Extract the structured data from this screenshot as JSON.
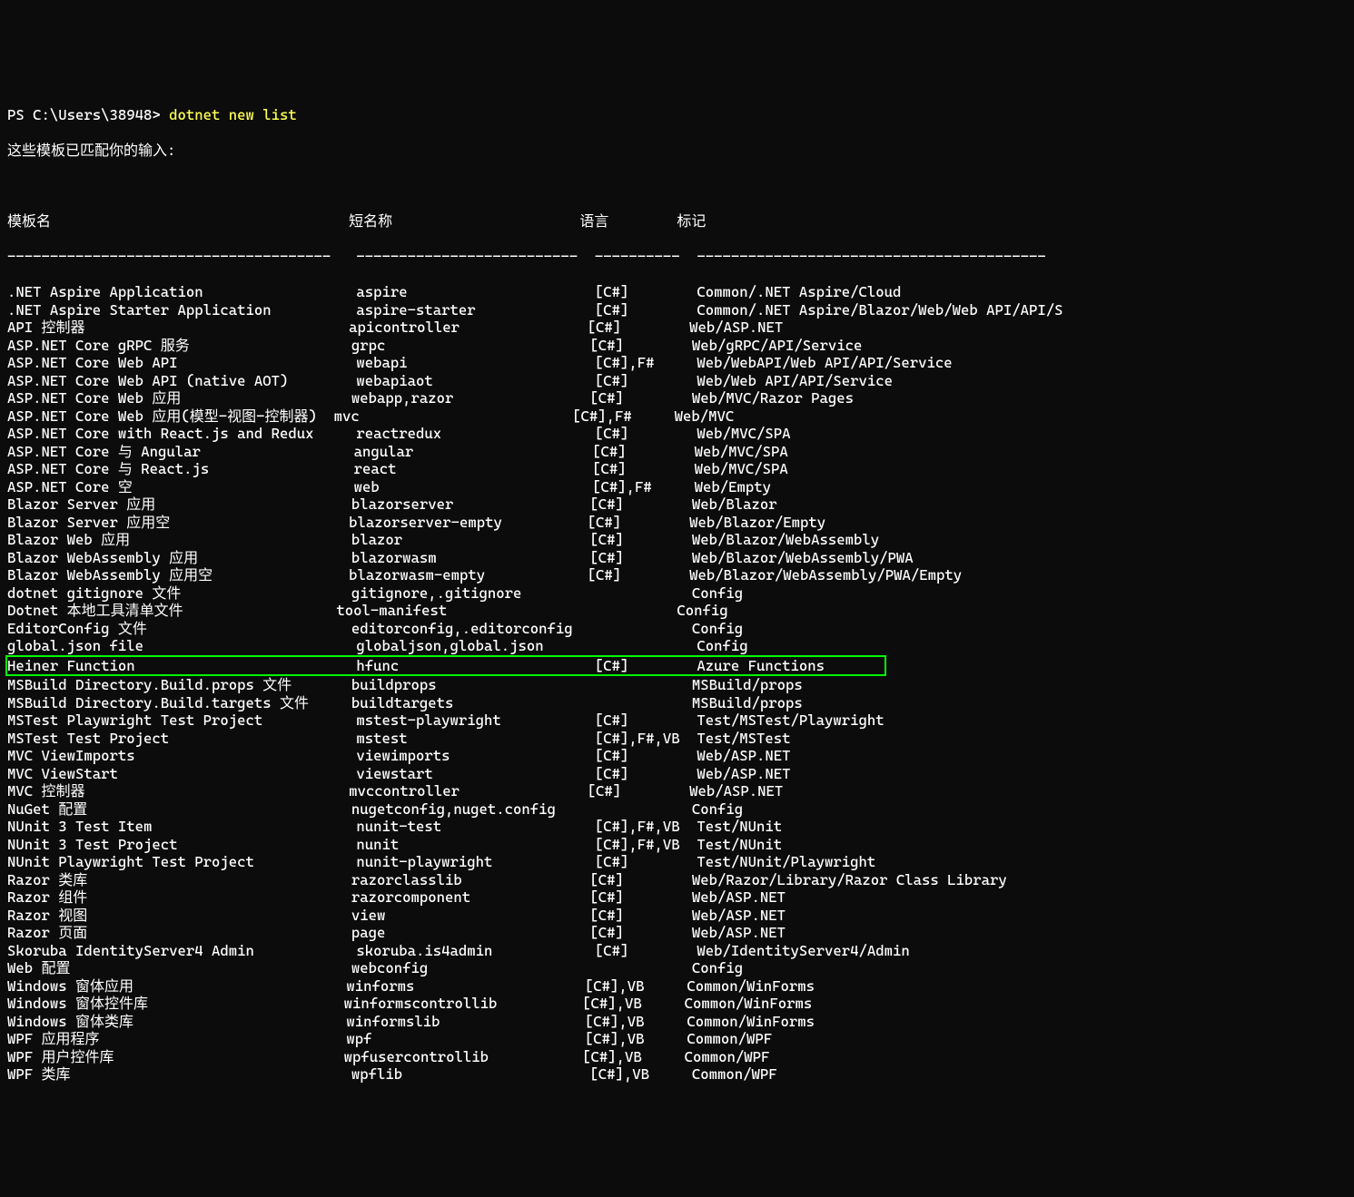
{
  "prompt_prefix": "PS C:\\Users\\38948> ",
  "command": "dotnet new list",
  "message": "这些模板已匹配你的输入:",
  "headers": {
    "name": "模板名",
    "short": "短名称",
    "lang": "语言",
    "tags": "标记"
  },
  "dashes": {
    "name": "--------------------------------------",
    "short": "--------------------------",
    "lang": "----------",
    "tags": "-----------------------------------------"
  },
  "rows": [
    {
      "name": ".NET Aspire Application",
      "short": "aspire",
      "lang": "[C#]",
      "tags": "Common/.NET Aspire/Cloud"
    },
    {
      "name": ".NET Aspire Starter Application",
      "short": "aspire-starter",
      "lang": "[C#]",
      "tags": "Common/.NET Aspire/Blazor/Web/Web API/API/S"
    },
    {
      "name": "API 控制器",
      "short": "apicontroller",
      "lang": "[C#]",
      "tags": "Web/ASP.NET"
    },
    {
      "name": "ASP.NET Core gRPC 服务",
      "short": "grpc",
      "lang": "[C#]",
      "tags": "Web/gRPC/API/Service"
    },
    {
      "name": "ASP.NET Core Web API",
      "short": "webapi",
      "lang": "[C#],F#",
      "tags": "Web/WebAPI/Web API/API/Service"
    },
    {
      "name": "ASP.NET Core Web API (native AOT)",
      "short": "webapiaot",
      "lang": "[C#]",
      "tags": "Web/Web API/API/Service"
    },
    {
      "name": "ASP.NET Core Web 应用",
      "short": "webapp,razor",
      "lang": "[C#]",
      "tags": "Web/MVC/Razor Pages"
    },
    {
      "name": "ASP.NET Core Web 应用(模型-视图-控制器)",
      "short": "mvc",
      "lang": "[C#],F#",
      "tags": "Web/MVC"
    },
    {
      "name": "ASP.NET Core with React.js and Redux",
      "short": "reactredux",
      "lang": "[C#]",
      "tags": "Web/MVC/SPA"
    },
    {
      "name": "ASP.NET Core 与 Angular",
      "short": "angular",
      "lang": "[C#]",
      "tags": "Web/MVC/SPA"
    },
    {
      "name": "ASP.NET Core 与 React.js",
      "short": "react",
      "lang": "[C#]",
      "tags": "Web/MVC/SPA"
    },
    {
      "name": "ASP.NET Core 空",
      "short": "web",
      "lang": "[C#],F#",
      "tags": "Web/Empty"
    },
    {
      "name": "Blazor Server 应用",
      "short": "blazorserver",
      "lang": "[C#]",
      "tags": "Web/Blazor"
    },
    {
      "name": "Blazor Server 应用空",
      "short": "blazorserver-empty",
      "lang": "[C#]",
      "tags": "Web/Blazor/Empty"
    },
    {
      "name": "Blazor Web 应用",
      "short": "blazor",
      "lang": "[C#]",
      "tags": "Web/Blazor/WebAssembly"
    },
    {
      "name": "Blazor WebAssembly 应用",
      "short": "blazorwasm",
      "lang": "[C#]",
      "tags": "Web/Blazor/WebAssembly/PWA"
    },
    {
      "name": "Blazor WebAssembly 应用空",
      "short": "blazorwasm-empty",
      "lang": "[C#]",
      "tags": "Web/Blazor/WebAssembly/PWA/Empty"
    },
    {
      "name": "dotnet gitignore 文件",
      "short": "gitignore,.gitignore",
      "lang": "",
      "tags": "Config"
    },
    {
      "name": "Dotnet 本地工具清单文件",
      "short": "tool-manifest",
      "lang": "",
      "tags": "Config"
    },
    {
      "name": "EditorConfig 文件",
      "short": "editorconfig,.editorconfig",
      "lang": "",
      "tags": "Config"
    },
    {
      "name": "global.json file",
      "short": "globaljson,global.json",
      "lang": "",
      "tags": "Config"
    },
    {
      "name": "Heiner Function",
      "short": "hfunc",
      "lang": "[C#]",
      "tags": "Azure Functions",
      "highlight": true
    },
    {
      "name": "MSBuild Directory.Build.props 文件",
      "short": "buildprops",
      "lang": "",
      "tags": "MSBuild/props"
    },
    {
      "name": "MSBuild Directory.Build.targets 文件",
      "short": "buildtargets",
      "lang": "",
      "tags": "MSBuild/props"
    },
    {
      "name": "MSTest Playwright Test Project",
      "short": "mstest-playwright",
      "lang": "[C#]",
      "tags": "Test/MSTest/Playwright"
    },
    {
      "name": "MSTest Test Project",
      "short": "mstest",
      "lang": "[C#],F#,VB",
      "tags": "Test/MSTest"
    },
    {
      "name": "MVC ViewImports",
      "short": "viewimports",
      "lang": "[C#]",
      "tags": "Web/ASP.NET"
    },
    {
      "name": "MVC ViewStart",
      "short": "viewstart",
      "lang": "[C#]",
      "tags": "Web/ASP.NET"
    },
    {
      "name": "MVC 控制器",
      "short": "mvccontroller",
      "lang": "[C#]",
      "tags": "Web/ASP.NET"
    },
    {
      "name": "NuGet 配置",
      "short": "nugetconfig,nuget.config",
      "lang": "",
      "tags": "Config"
    },
    {
      "name": "NUnit 3 Test Item",
      "short": "nunit-test",
      "lang": "[C#],F#,VB",
      "tags": "Test/NUnit"
    },
    {
      "name": "NUnit 3 Test Project",
      "short": "nunit",
      "lang": "[C#],F#,VB",
      "tags": "Test/NUnit"
    },
    {
      "name": "NUnit Playwright Test Project",
      "short": "nunit-playwright",
      "lang": "[C#]",
      "tags": "Test/NUnit/Playwright"
    },
    {
      "name": "Razor 类库",
      "short": "razorclasslib",
      "lang": "[C#]",
      "tags": "Web/Razor/Library/Razor Class Library"
    },
    {
      "name": "Razor 组件",
      "short": "razorcomponent",
      "lang": "[C#]",
      "tags": "Web/ASP.NET"
    },
    {
      "name": "Razor 视图",
      "short": "view",
      "lang": "[C#]",
      "tags": "Web/ASP.NET"
    },
    {
      "name": "Razor 页面",
      "short": "page",
      "lang": "[C#]",
      "tags": "Web/ASP.NET"
    },
    {
      "name": "Skoruba IdentityServer4 Admin",
      "short": "skoruba.is4admin",
      "lang": "[C#]",
      "tags": "Web/IdentityServer4/Admin"
    },
    {
      "name": "Web 配置",
      "short": "webconfig",
      "lang": "",
      "tags": "Config"
    },
    {
      "name": "Windows 窗体应用",
      "short": "winforms",
      "lang": "[C#],VB",
      "tags": "Common/WinForms"
    },
    {
      "name": "Windows 窗体控件库",
      "short": "winformscontrollib",
      "lang": "[C#],VB",
      "tags": "Common/WinForms"
    },
    {
      "name": "Windows 窗体类库",
      "short": "winformslib",
      "lang": "[C#],VB",
      "tags": "Common/WinForms"
    },
    {
      "name": "WPF 应用程序",
      "short": "wpf",
      "lang": "[C#],VB",
      "tags": "Common/WPF"
    },
    {
      "name": "WPF 用户控件库",
      "short": "wpfusercontrollib",
      "lang": "[C#],VB",
      "tags": "Common/WPF"
    },
    {
      "name": "WPF 类库",
      "short": "wpflib",
      "lang": "[C#],VB",
      "tags": "Common/WPF"
    }
  ],
  "col_widths": {
    "name": 41,
    "short": 28,
    "lang": 12
  }
}
